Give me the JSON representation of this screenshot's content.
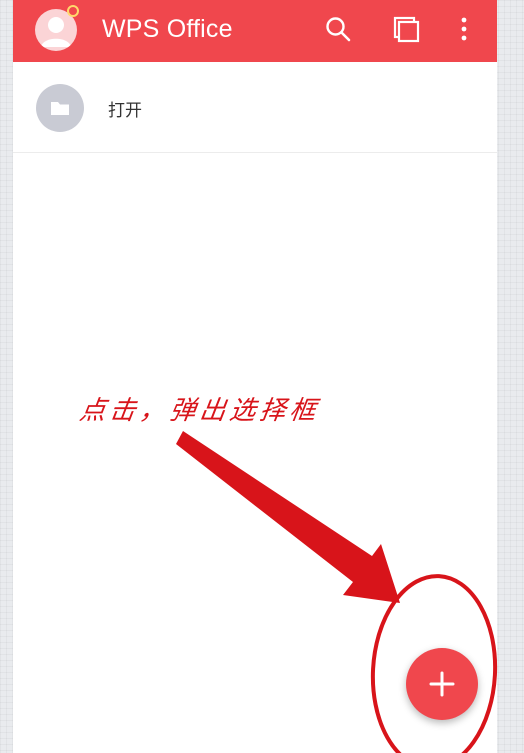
{
  "colors": {
    "appbar": "#f0474d",
    "fab": "#f0474d",
    "annotation": "#d8141a",
    "folder_circle": "#c9cbd4",
    "avatar_dot": "#ffd86b"
  },
  "appbar": {
    "title": "WPS Office",
    "icons": [
      "avatar-icon",
      "search-icon",
      "windows-icon",
      "more-vert-icon"
    ]
  },
  "list": {
    "items": [
      {
        "icon": "folder-icon",
        "label": "打开"
      }
    ]
  },
  "fab": {
    "icon": "plus-icon"
  },
  "annotation": {
    "text": "点击，弹出选择框"
  }
}
